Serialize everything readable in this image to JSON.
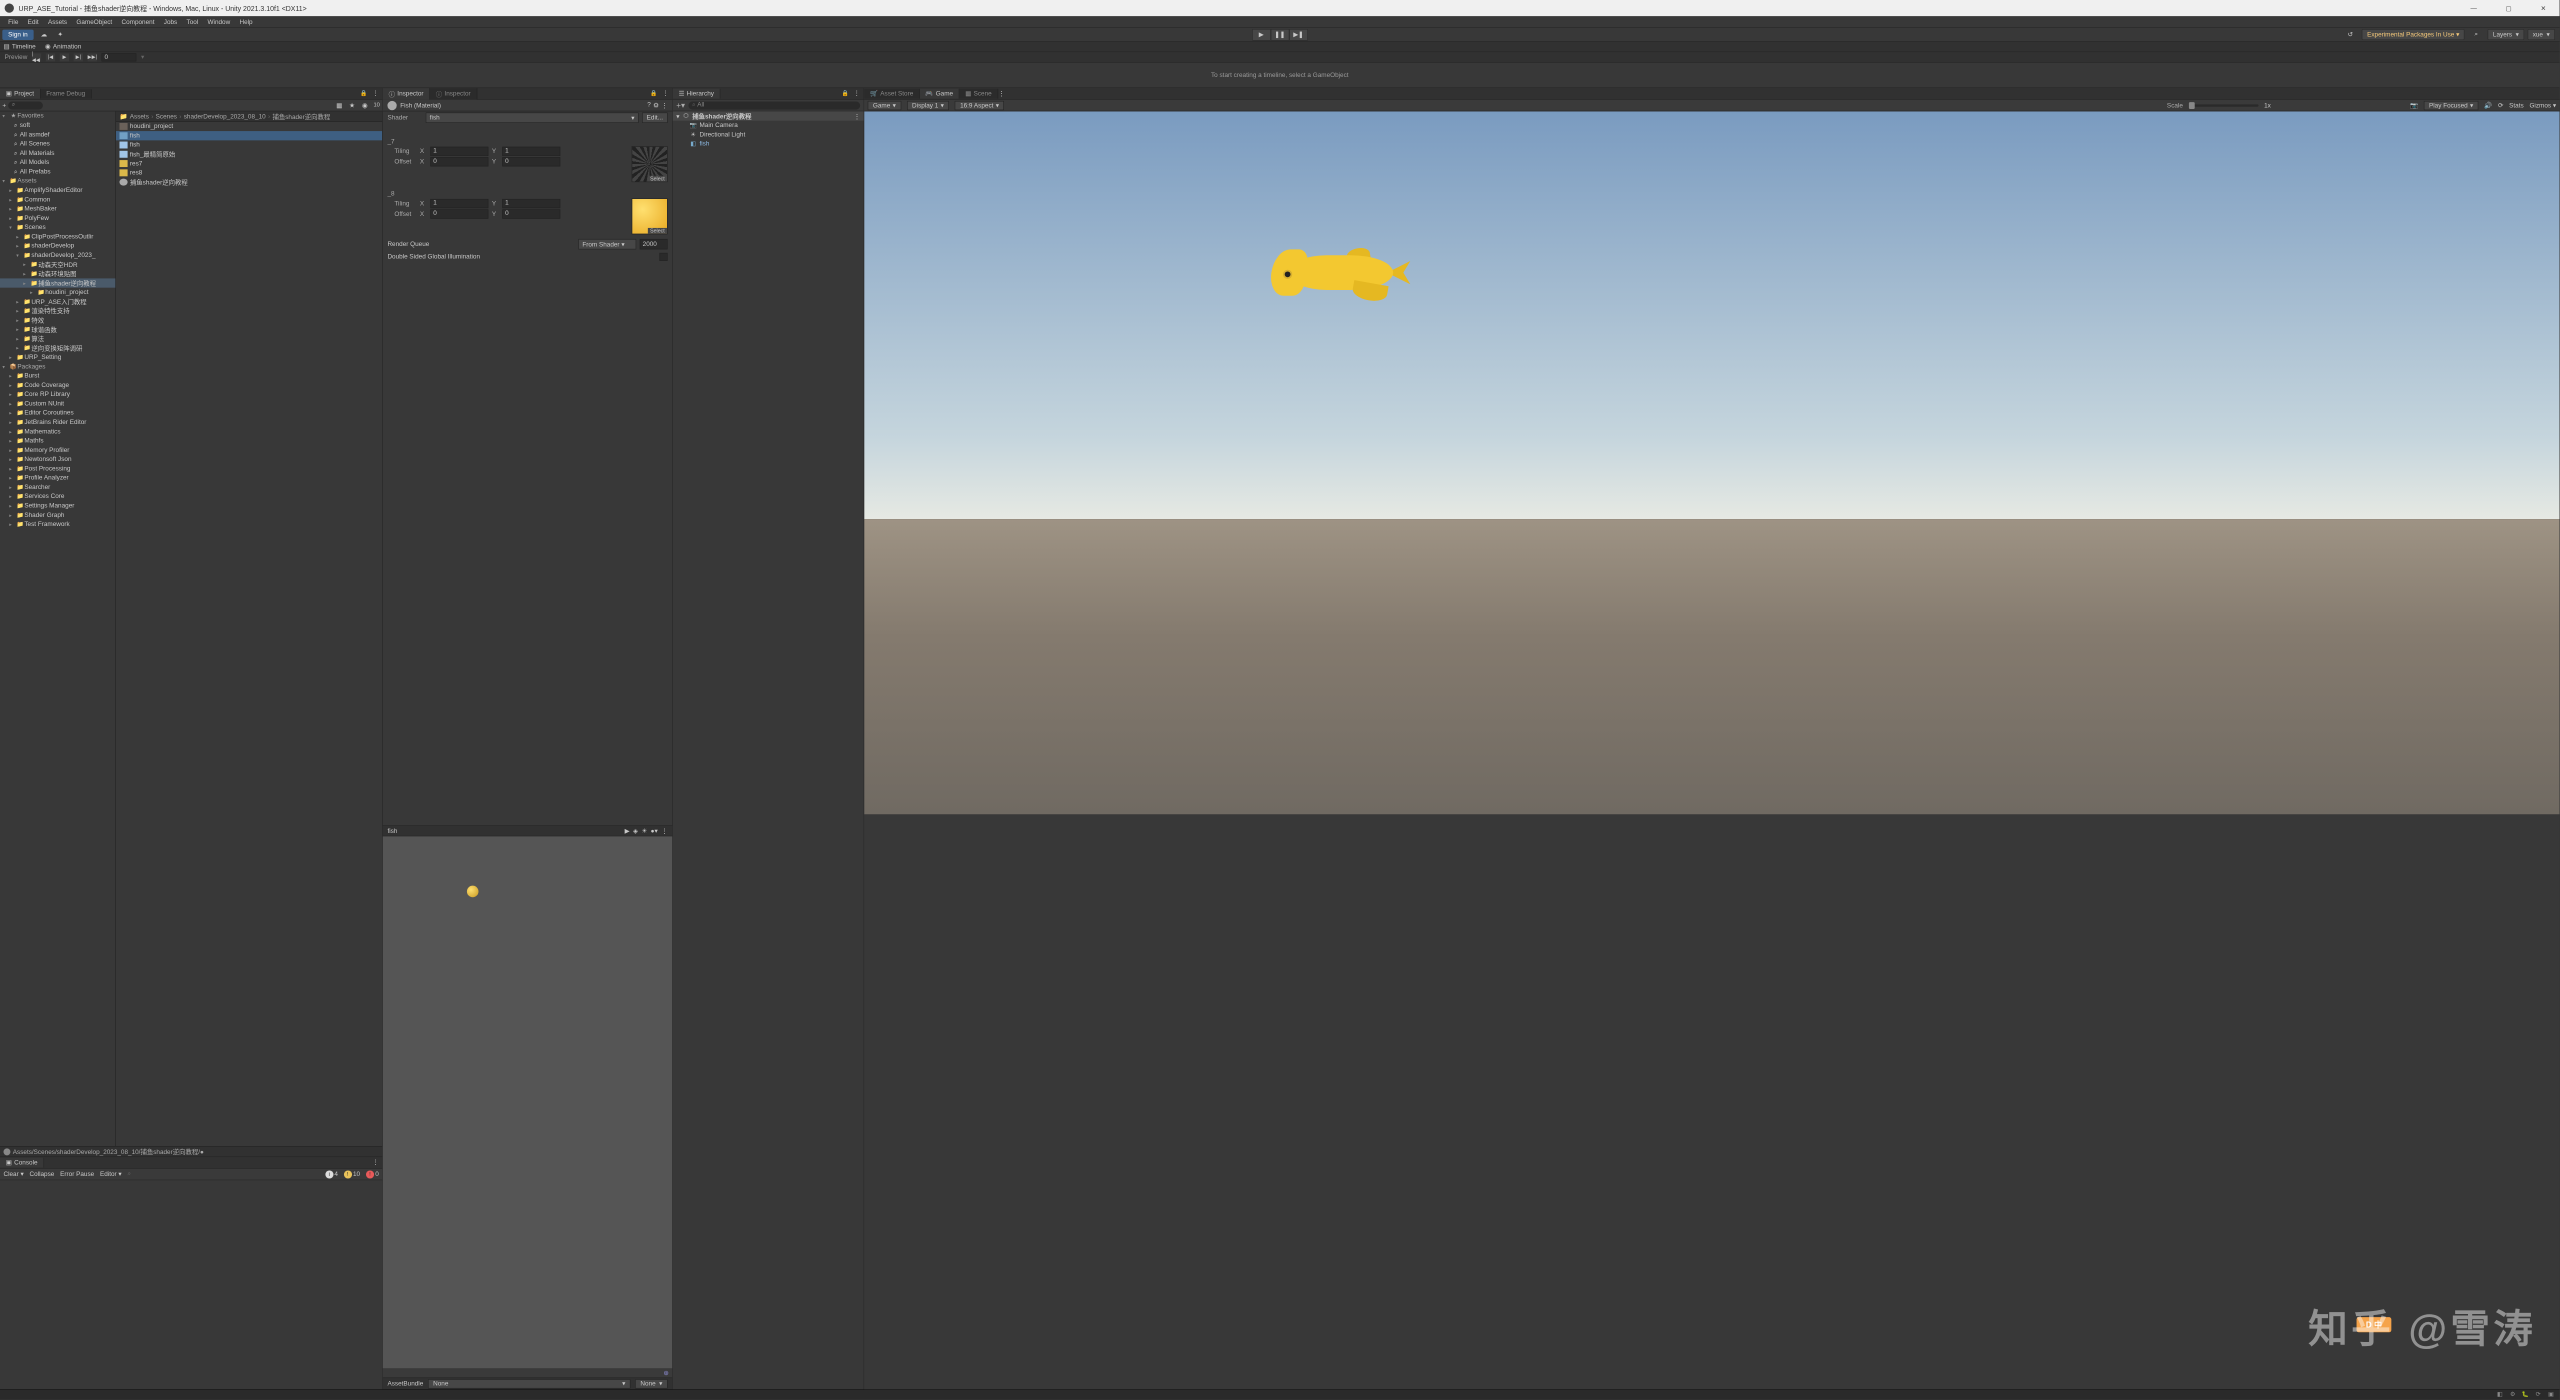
{
  "window": {
    "title": "URP_ASE_Tutorial - 捕鱼shader逆向教程 - Windows, Mac, Linux - Unity 2021.3.10f1 <DX11>"
  },
  "menu": [
    "File",
    "Edit",
    "Assets",
    "GameObject",
    "Component",
    "Jobs",
    "Tool",
    "Window",
    "Help"
  ],
  "toolbar": {
    "signin": "Sign in",
    "experimental": "Experimental Packages In Use ▾",
    "layers": "Layers",
    "layout": "xue"
  },
  "timeline": {
    "tab_timeline": "Timeline",
    "tab_animation": "Animation",
    "preview_label": "Preview",
    "frame": "0",
    "message": "To start creating a timeline, select a GameObject"
  },
  "project": {
    "tab_project": "Project",
    "tab_framedebug": "Frame Debug",
    "search_ph": "⌕",
    "icon_count": "10",
    "favorites_hdr": "Favorites",
    "favorites": [
      "soft",
      "All asmdef",
      "All Scenes",
      "All Materials",
      "All Models",
      "All Prefabs"
    ],
    "assets_hdr": "Assets",
    "assets_tree": [
      {
        "name": "AmplifyShaderEditor",
        "d": 1
      },
      {
        "name": "Common",
        "d": 1
      },
      {
        "name": "MeshBaker",
        "d": 1
      },
      {
        "name": "PolyFew",
        "d": 1
      },
      {
        "name": "Scenes",
        "d": 1,
        "open": true
      },
      {
        "name": "ClipPostProcessOutlir",
        "d": 2
      },
      {
        "name": "shaderDevelop",
        "d": 2
      },
      {
        "name": "shaderDevelop_2023_",
        "d": 2,
        "open": true
      },
      {
        "name": "动森天空HDR",
        "d": 3
      },
      {
        "name": "动森环境贴图",
        "d": 3
      },
      {
        "name": "捕鱼shader逆向教程",
        "d": 3,
        "sel": true
      },
      {
        "name": "houdini_project",
        "d": 4
      },
      {
        "name": "URP_ASE入门教程",
        "d": 2
      },
      {
        "name": "渲染特性支持",
        "d": 2
      },
      {
        "name": "特效",
        "d": 2
      },
      {
        "name": "球谐函数",
        "d": 2
      },
      {
        "name": "算法",
        "d": 2
      },
      {
        "name": "逆向变换矩阵调研",
        "d": 2
      },
      {
        "name": "URP_Setting",
        "d": 1
      }
    ],
    "packages_hdr": "Packages",
    "packages": [
      "Burst",
      "Code Coverage",
      "Core RP Library",
      "Custom NUnit",
      "Editor Coroutines",
      "JetBrains Rider Editor",
      "Mathematics",
      "Mathfs",
      "Memory Profiler",
      "Newtonsoft Json",
      "Post Processing",
      "Profile Analyzer",
      "Searcher",
      "Services Core",
      "Settings Manager",
      "Shader Graph",
      "Test Framework"
    ],
    "breadcrumb": [
      "Assets",
      "Scenes",
      "shaderDevelop_2023_08_10",
      "捕鱼shader逆向教程"
    ],
    "files": [
      {
        "name": "houdini_project",
        "t": "folder"
      },
      {
        "name": "fish",
        "t": "mesh",
        "sel": true
      },
      {
        "name": "fish",
        "t": "prefab"
      },
      {
        "name": "fish_最精简原始",
        "t": "prefab"
      },
      {
        "name": "res7",
        "t": "img"
      },
      {
        "name": "res8",
        "t": "img"
      },
      {
        "name": "捕鱼shader逆向教程",
        "t": "unity"
      }
    ],
    "path": "Assets/Scenes/shaderDevelop_2023_08_10/捕鱼shader逆向教程/●"
  },
  "console": {
    "tab": "Console",
    "ctrls": [
      "Clear ▾",
      "Collapse",
      "Error Pause",
      "Editor ▾"
    ],
    "search_ph": "⌕",
    "info": "4",
    "warn": "10",
    "err": "0"
  },
  "inspector": {
    "tab1": "Inspector",
    "tab2": "Inspector",
    "mat_name": "Fish (Material)",
    "shader_lbl": "Shader",
    "shader_val": "fish",
    "edit_btn": "Edit...",
    "slots": [
      {
        "sect": "_7",
        "tiling_x": "1",
        "tiling_y": "1",
        "offset_x": "0",
        "offset_y": "0",
        "select": "Select",
        "tex": "noise"
      },
      {
        "sect": "_8",
        "tiling_x": "1",
        "tiling_y": "1",
        "offset_x": "0",
        "offset_y": "0",
        "select": "Select",
        "tex": "yellow"
      }
    ],
    "tiling_lbl": "Tiling",
    "offset_lbl": "Offset",
    "x_lbl": "X",
    "y_lbl": "Y",
    "render_queue_lbl": "Render Queue",
    "render_queue_mode": "From Shader ▾",
    "render_queue_val": "2000",
    "dsgi_lbl": "Double Sided Global Illumination",
    "preview_name": "fish",
    "assetbundle_lbl": "AssetBundle",
    "assetbundle_val": "None",
    "assetbundle_val2": "None"
  },
  "hierarchy": {
    "tab": "Hierarchy",
    "search_ph": "All",
    "scene": "捕鱼shader逆向教程",
    "items": [
      "Main Camera",
      "Directional Light",
      "fish"
    ]
  },
  "game": {
    "tabs": [
      {
        "label": "Asset Store",
        "active": false
      },
      {
        "label": "Game",
        "active": true
      },
      {
        "label": "Scene",
        "active": false
      }
    ],
    "mode": "Game",
    "display": "Display 1",
    "aspect": "16:9 Aspect",
    "scale_lbl": "Scale",
    "scale_val": "1x",
    "play_focused": "Play Focused",
    "stats": "Stats",
    "gizmos": "Gizmos"
  },
  "watermark": "知乎 @雪涛",
  "watermark_badge": "D 中"
}
